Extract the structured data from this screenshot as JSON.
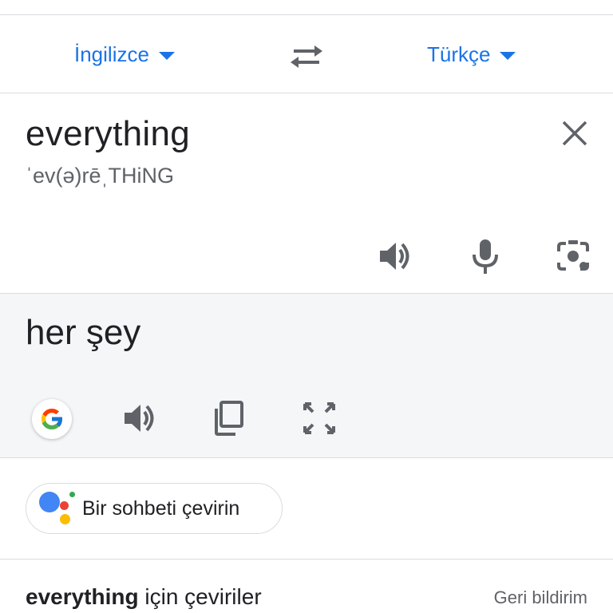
{
  "languages": {
    "source_label": "İngilizce",
    "target_label": "Türkçe"
  },
  "source": {
    "text": "everything",
    "phonetic": "ˈev(ə)rēˌTHiNG"
  },
  "target": {
    "text": "her şey"
  },
  "chip": {
    "label": "Bir sohbeti çevirin"
  },
  "translations": {
    "word": "everything",
    "title_suffix": " için çeviriler",
    "feedback_label": "Geri bildirim"
  },
  "colors": {
    "accent": "#1a73e8",
    "icon": "#5f6368",
    "target_bg": "#f5f6f8"
  },
  "icons": {
    "swap": "swap-icon",
    "clear": "close-icon",
    "listen": "speaker-icon",
    "mic": "mic-icon",
    "camera": "camera-icon",
    "google": "google-logo-icon",
    "copy": "copy-icon",
    "fullscreen": "fullscreen-icon",
    "assistant": "assistant-icon"
  }
}
